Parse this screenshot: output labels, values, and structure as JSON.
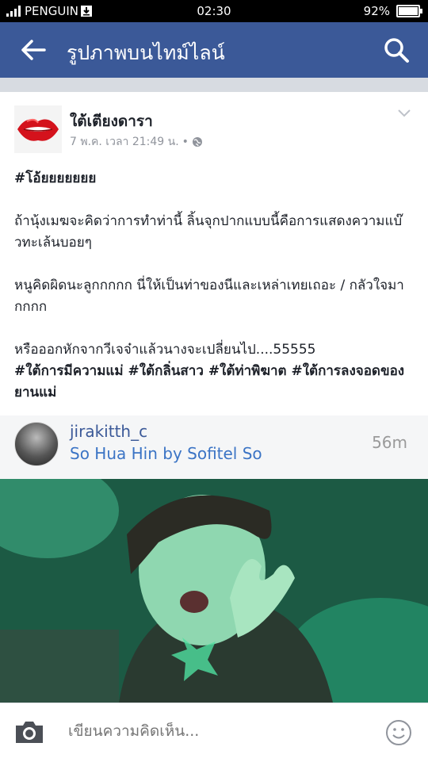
{
  "status_bar": {
    "carrier": "PENGUIN",
    "time": "02:30",
    "battery": "92%",
    "battery_level": 0.92
  },
  "app_bar": {
    "title": "รูปภาพบนไทม์ไลน์"
  },
  "post": {
    "page_name": "ใต้เตียงดารา",
    "timestamp": "7 พ.ค. เวลา 21:49 น.",
    "separator": "•",
    "headline": "#โอ้ยยยยยยย",
    "paragraph1": "ถ้านุ้งเมฆจะคิดว่าการทำท่านี้ ลิ้นจุกปากแบบนี้คือการแสดงความแบ๊วทะเล้นบอยๆ",
    "paragraph2": "หนูคิดผิดนะลูกกกกก นี่ให้เป็นท่าของนีและเหล่าเทยเถอะ / กลัวใจมากกกก",
    "paragraph3": "หรือออกหักจากวีเจจ๋าแล้วนางจะเปลี่ยนไป....55555",
    "hashtags": "#ใต้การมีความแม่ #ใต้กลิ่นสาว #ใต้ท่าพิฆาต #ใต้การลงจอดของยานแม่"
  },
  "instagram": {
    "username": "jirakitth_c",
    "location": "So Hua Hin by Sofitel So",
    "time_ago": "56m"
  },
  "comment": {
    "placeholder": "เขียนความคิดเห็น..."
  },
  "colors": {
    "facebook_blue": "#3b5998",
    "link_blue": "#3b74c5"
  }
}
